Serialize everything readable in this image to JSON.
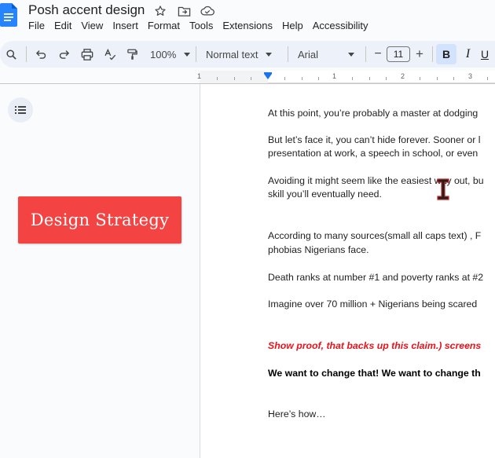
{
  "app": {
    "title": "Posh accent design",
    "menu": [
      "File",
      "Edit",
      "View",
      "Insert",
      "Format",
      "Tools",
      "Extensions",
      "Help",
      "Accessibility"
    ]
  },
  "toolbar": {
    "zoom": "100%",
    "style": "Normal text",
    "font": "Arial",
    "font_size": "11",
    "bold_label": "B",
    "italic_label": "I",
    "underline_label": "U",
    "minus_label": "−",
    "plus_label": "+"
  },
  "ruler": {
    "numbers": [
      "1",
      "1",
      "2",
      "3"
    ]
  },
  "sidebar": {
    "design_label": "Design Strategy"
  },
  "document": {
    "lines": [
      "At this point, you’re probably a master at dodging",
      "But let’s face it, you can’t hide forever. Sooner or l",
      "presentation at work, a speech in school, or even",
      "Avoiding it might seem like the easiest way out, bu",
      "skill you’ll eventually need.",
      "According to many sources(small all caps text) , F",
      "phobias Nigerians face.",
      "Death ranks at number #1 and poverty ranks at #2",
      "Imagine over 70 million + Nigerians being scared",
      "Show proof, that backs up this claim.) screens",
      "We want to change that! We want to change th",
      "Here’s how…"
    ]
  },
  "colors": {
    "accent_blue": "#1a73e8",
    "design_box": "#f44343",
    "red_text": "#e8131b"
  }
}
